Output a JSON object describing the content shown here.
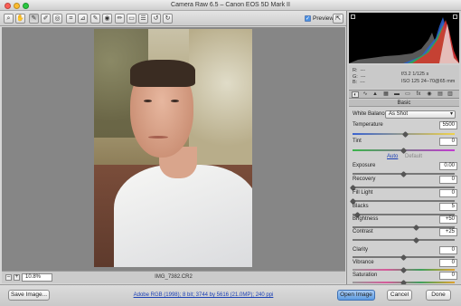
{
  "window": {
    "title": "Camera Raw 6.5  –  Canon EOS 5D Mark II"
  },
  "toolbar": {
    "tools": [
      "zoom-icon",
      "hand-icon",
      "white-balance-icon",
      "color-sampler-icon",
      "target-adjustment-icon",
      "crop-icon",
      "straighten-icon",
      "spot-removal-icon",
      "red-eye-icon",
      "adjustment-brush-icon",
      "graduated-filter-icon",
      "preferences-icon",
      "rotate-left-icon",
      "rotate-right-icon"
    ],
    "preview_label": "Preview",
    "preview_checked": true
  },
  "canvas": {
    "zoom": "10.8%",
    "filename": "IMG_7382.CR2"
  },
  "readout": {
    "r": "R:",
    "g": "G:",
    "b": "B:",
    "dashes": "---",
    "aperture_shutter": "f/3.2    1/125 s",
    "iso_lens": "ISO 125    24–70@65 mm"
  },
  "panel": {
    "section_title": "Basic"
  },
  "basic": {
    "white_balance_label": "White Balance:",
    "white_balance_value": "As Shot",
    "temperature": {
      "label": "Temperature",
      "value": "5500",
      "level": 0.52
    },
    "tint": {
      "label": "Tint",
      "value": "0",
      "level": 0.5
    },
    "auto_label": "Auto",
    "default_label": "Default",
    "exposure": {
      "label": "Exposure",
      "value": "0.00",
      "level": 0.5
    },
    "recovery": {
      "label": "Recovery",
      "value": "0",
      "level": 0.0
    },
    "fill_light": {
      "label": "Fill Light",
      "value": "0",
      "level": 0.0
    },
    "blacks": {
      "label": "Blacks",
      "value": "5",
      "level": 0.05
    },
    "brightness": {
      "label": "Brightness",
      "value": "+50",
      "level": 0.62
    },
    "contrast": {
      "label": "Contrast",
      "value": "+25",
      "level": 0.62
    },
    "clarity": {
      "label": "Clarity",
      "value": "0",
      "level": 0.5
    },
    "vibrance": {
      "label": "Vibrance",
      "value": "0",
      "level": 0.5
    },
    "saturation": {
      "label": "Saturation",
      "value": "0",
      "level": 0.5
    }
  },
  "footer": {
    "save_label": "Save Image...",
    "workflow_link": "Adobe RGB (1998); 8 bit; 3744 by 5616 (21.0MP); 240 ppi",
    "open_label": "Open Image",
    "cancel_label": "Cancel",
    "done_label": "Done"
  },
  "colors": {
    "accent": "#4a90e2",
    "link": "#1a3fb5"
  }
}
